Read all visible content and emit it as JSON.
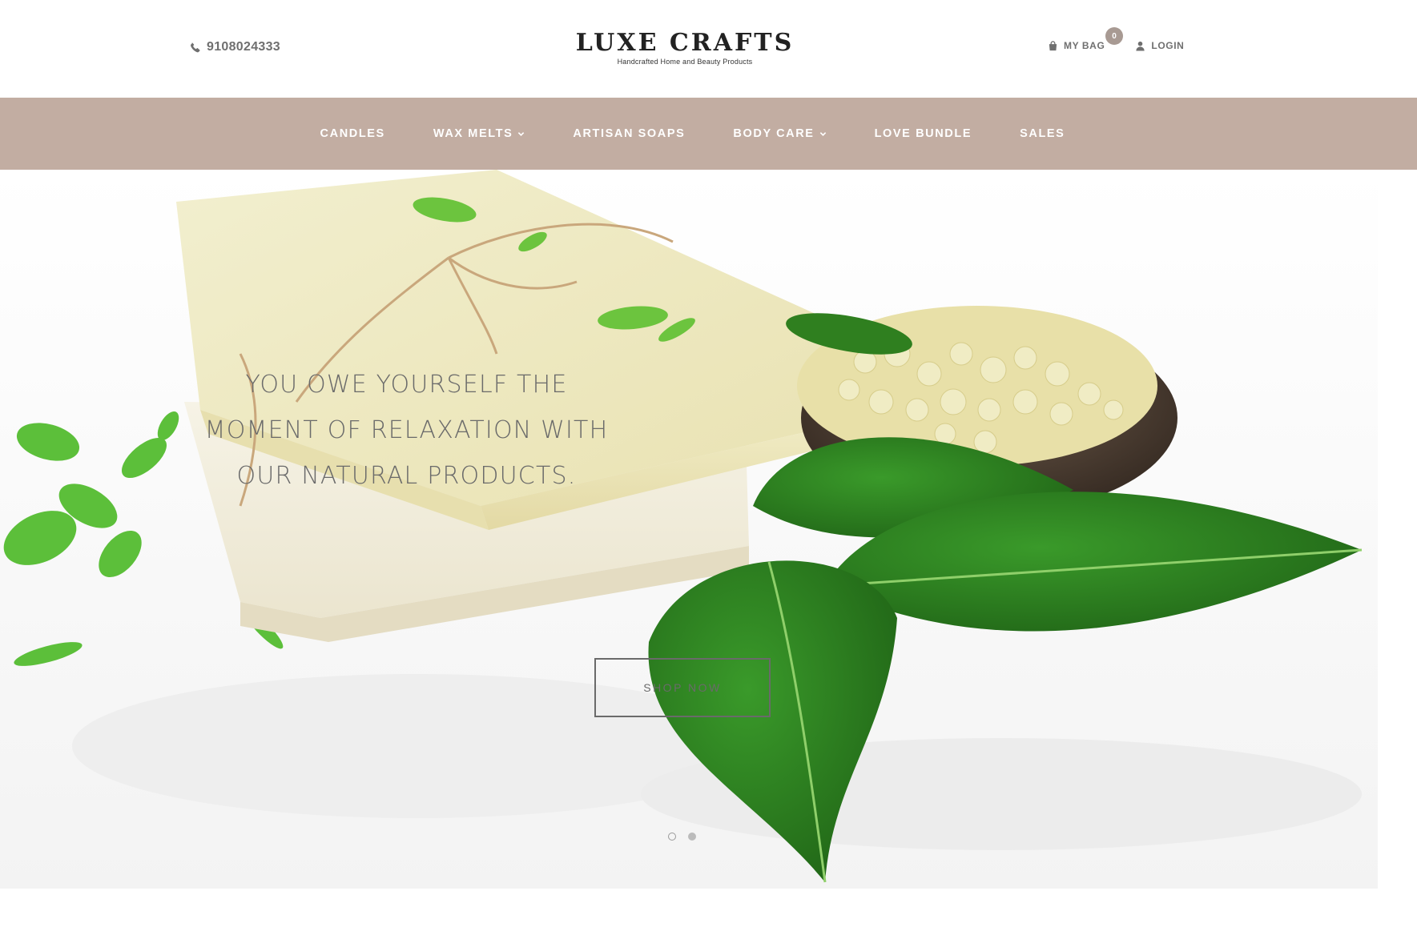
{
  "header": {
    "phone": "9108024333",
    "logo_title": "LUXE CRAFTS",
    "logo_tagline": "Handcrafted Home and Beauty Products",
    "bag_label": "MY BAG",
    "bag_count": "0",
    "login_label": "LOGIN"
  },
  "nav": {
    "items": [
      {
        "label": "CANDLES",
        "has_dropdown": false
      },
      {
        "label": "WAX MELTS",
        "has_dropdown": true
      },
      {
        "label": "ARTISAN SOAPS",
        "has_dropdown": false
      },
      {
        "label": "BODY CARE",
        "has_dropdown": true
      },
      {
        "label": "LOVE BUNDLE",
        "has_dropdown": false
      },
      {
        "label": "SALES",
        "has_dropdown": false
      }
    ]
  },
  "hero": {
    "headline_line1": "YOU OWE YOURSELF THE",
    "headline_line2": "MOMENT OF RELAXATION WITH",
    "headline_line3": "OUR NATURAL PRODUCTS.",
    "cta_label": "SHOP NOW",
    "slides_total": 2,
    "active_slide": 2
  },
  "colors": {
    "nav_background": "#c2ada2",
    "badge_background": "#a89a93",
    "text_muted": "#6f6f6f"
  },
  "icons": {
    "phone": "phone-icon",
    "bag": "shopping-bag-icon",
    "user": "user-icon",
    "dropdown": "chevron-down-icon"
  }
}
